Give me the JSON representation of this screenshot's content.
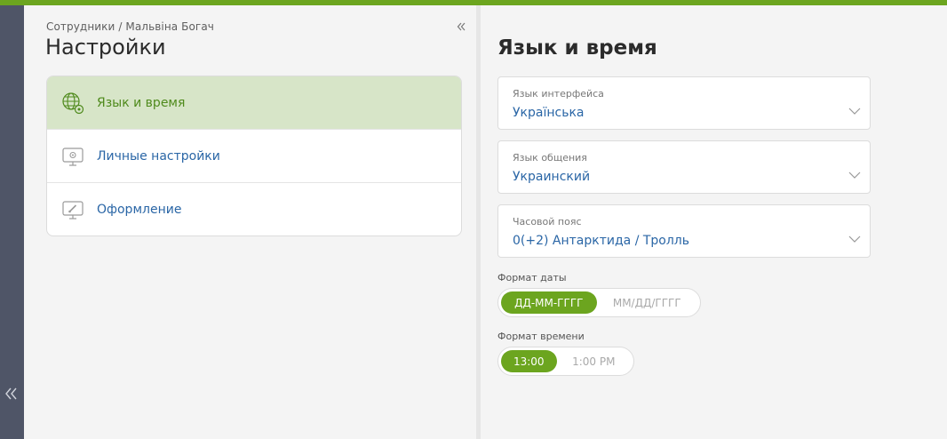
{
  "colors": {
    "accent_green": "#6ca51f",
    "active_item_bg": "#d7e5c8",
    "link_blue": "#2a66a6",
    "rail": "#4f5567"
  },
  "left": {
    "breadcrumb": "Сотрудники / Мальвіна Богач",
    "title": "Настройки",
    "collapse_icon": "double-chevron-left-icon",
    "menu": [
      {
        "label": "Язык и время",
        "icon": "globe-gear-icon",
        "active": true
      },
      {
        "label": "Личные настройки",
        "icon": "monitor-gear-icon",
        "active": false
      },
      {
        "label": "Оформление",
        "icon": "monitor-brush-icon",
        "active": false
      }
    ]
  },
  "rail": {
    "toggle_icon": "double-chevron-left-icon"
  },
  "right": {
    "title": "Язык и время",
    "fields": [
      {
        "label": "Язык интерфейса",
        "value": "Українська"
      },
      {
        "label": "Язык общения",
        "value": "Украинский"
      },
      {
        "label": "Часовой пояс",
        "value": "0(+2) Антарктида / Тролль"
      }
    ],
    "date_format": {
      "label": "Формат даты",
      "options": [
        "ДД-ММ-ГГГГ",
        "ММ/ДД/ГГГГ"
      ],
      "selected": "ДД-ММ-ГГГГ"
    },
    "time_format": {
      "label": "Формат времени",
      "options": [
        "13:00",
        "1:00 PM"
      ],
      "selected": "13:00"
    }
  }
}
